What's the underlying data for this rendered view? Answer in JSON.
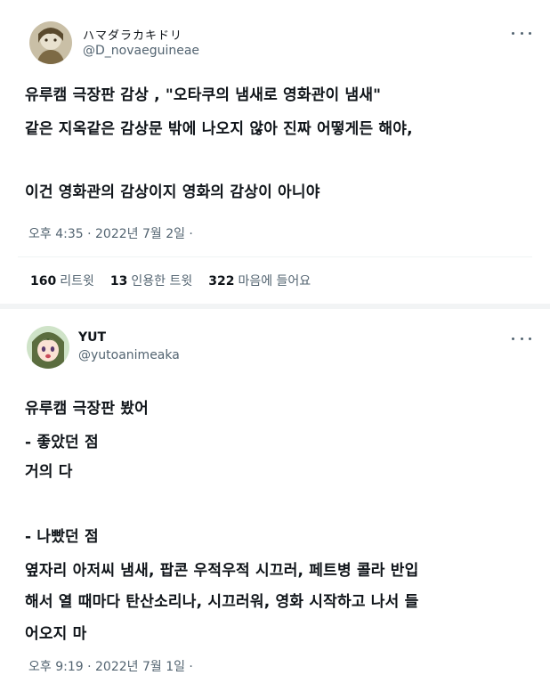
{
  "tweets": [
    {
      "display_name": "ハマダラカキドリ",
      "handle": "@D_novaeguineae",
      "lines": [
        "유루캠 극장판 감상 , \"오타쿠의 냄새로 영화관이 냄새\"",
        "같은 지옥같은 감상문 밖에 나오지 않아 진짜 어떻게든 해야,",
        "",
        "이건 영화관의 감상이지 영화의 감상이 아니야"
      ],
      "timestamp": "오후 4:35 · 2022년 7월 2일 ·",
      "stats": [
        {
          "count": "160",
          "label": "리트윗"
        },
        {
          "count": "13",
          "label": "인용한 트윗"
        },
        {
          "count": "322",
          "label": "마음에 들어요"
        }
      ]
    },
    {
      "display_name": "YUT",
      "handle": "@yutoanimeaka",
      "lines": [
        "유루캠 극장판 봤어",
        "- 좋았던 점",
        "거의 다",
        "",
        "- 나빴던 점",
        "옆자리 아저씨 냄새, 팝콘 우적우적 시끄러, 페트병 콜라 반입",
        "해서 열 때마다 탄산소리나, 시끄러워, 영화 시작하고 나서 들",
        "어오지 마"
      ],
      "timestamp": "오후 9:19 · 2022년 7월 1일 ·"
    }
  ],
  "icons": {
    "more": "more-horizontal-icon"
  }
}
